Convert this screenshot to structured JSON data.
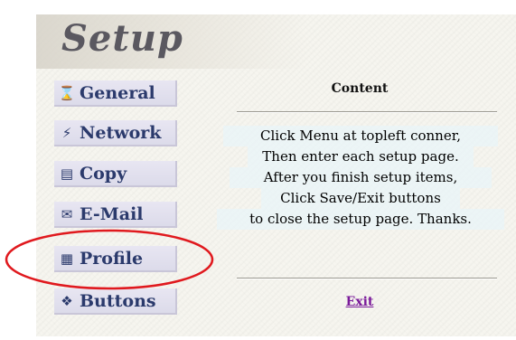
{
  "page": {
    "title": "Setup"
  },
  "sidebar": {
    "items": [
      {
        "label": "General",
        "icon": "hourglass-icon",
        "glyph": "⌛"
      },
      {
        "label": "Network",
        "icon": "network-icon",
        "glyph": "⚡"
      },
      {
        "label": "Copy",
        "icon": "copy-icon",
        "glyph": "▤"
      },
      {
        "label": "E-Mail",
        "icon": "email-icon",
        "glyph": "✉"
      },
      {
        "label": "Profile",
        "icon": "profile-icon",
        "glyph": "▦"
      },
      {
        "label": "Buttons",
        "icon": "buttons-icon",
        "glyph": "❖"
      }
    ]
  },
  "content": {
    "heading": "Content",
    "lines": [
      "Click Menu at topleft conner,",
      "Then enter each setup page.",
      "After you finish setup items,",
      "Click Save/Exit buttons",
      "to close the setup page. Thanks."
    ],
    "exit_label": "Exit"
  },
  "colors": {
    "menu_text": "#2b3a6c",
    "exit_link": "#7a1a9a",
    "annotation": "#e0191e"
  }
}
